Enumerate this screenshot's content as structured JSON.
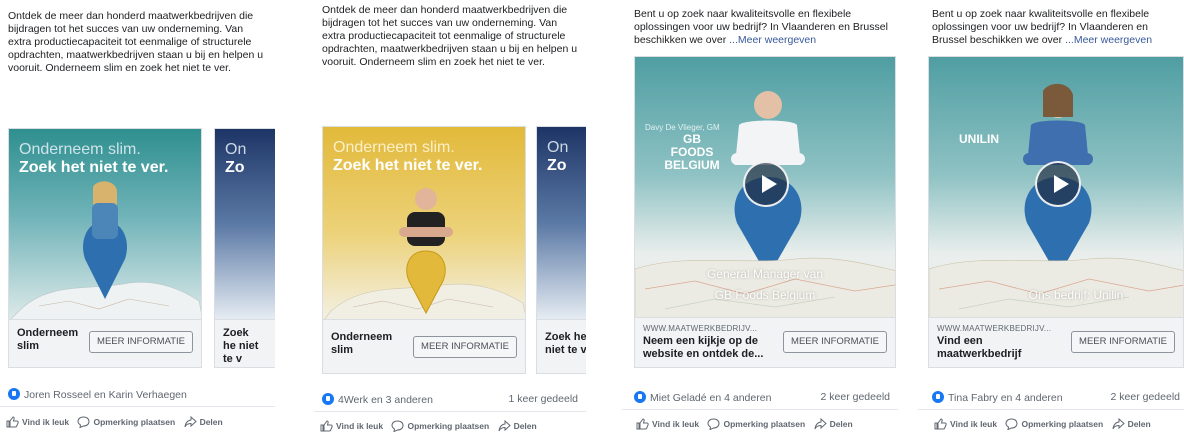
{
  "posts": [
    {
      "text": "Ontdek de meer dan honderd maatwerkbedrijven die bijdragen tot het succes van uw onderneming. Van extra productiecapaciteit tot eenmalige of structurele opdrachten, maatwerkbedrijven staan u bij en helpen u vooruit. Onderneem slim en zoek het niet te ver.",
      "card1": {
        "headline_light": "Onderneem slim.",
        "headline_bold": "Zoek het niet te ver.",
        "title": "Onderneem slim",
        "cta": "MEER INFORMATIE"
      },
      "card2": {
        "headline_light": "On",
        "headline_bold": "Zo",
        "title": "Zoek he niet te v"
      },
      "reactions": "Joren Rosseel en Karin Verhaegen",
      "shares": "",
      "actions": {
        "like": "Vind ik leuk",
        "comment": "Opmerking plaatsen",
        "share": "Delen"
      }
    },
    {
      "text": "Ontdek de meer dan honderd maatwerkbedrijven die bijdragen tot het succes van uw onderneming. Van extra productiecapaciteit tot eenmalige of structurele opdrachten, maatwerkbedrijven staan u bij en helpen u vooruit. Onderneem slim en zoek het niet te ver.",
      "card1": {
        "headline_light": "Onderneem slim.",
        "headline_bold": "Zoek het niet te ver.",
        "title": "Onderneem slim",
        "cta": "MEER INFORMATIE"
      },
      "card2": {
        "headline_light": "On",
        "headline_bold": "Zo",
        "title": "Zoek he niet te v"
      },
      "reactions": "4Werk en 3 anderen",
      "shares": "1 keer gedeeld",
      "actions": {
        "like": "Vind ik leuk",
        "comment": "Opmerking plaatsen",
        "share": "Delen"
      }
    },
    {
      "text": "Bent u op zoek naar kwaliteitsvolle en flexibele oplossingen voor uw bedrijf? In Vlaanderen en Brussel beschikken we over",
      "more": "...Meer weergeven",
      "video": {
        "name_tag": "Davy De Vlieger, GM",
        "brand": "GB FOODS BELGIUM",
        "caption_1": "General Manager van",
        "caption_2": "GB Foods Belgium"
      },
      "domain": "WWW.MAATWERKBEDRIJV...",
      "title": "Neem een kijkje op de website en ontdek de...",
      "cta": "MEER INFORMATIE",
      "reactions": "Miet Geladé en 4 anderen",
      "shares": "2 keer gedeeld",
      "actions": {
        "like": "Vind ik leuk",
        "comment": "Opmerking plaatsen",
        "share": "Delen"
      }
    },
    {
      "text": "Bent u op zoek naar kwaliteitsvolle en flexibele oplossingen voor uw bedrijf? In Vlaanderen en Brussel beschikken we over",
      "more": "...Meer weergeven",
      "video": {
        "brand": "UNILIN",
        "caption_1": "Ons bedrijf: Unilin"
      },
      "domain": "WWW.MAATWERKBEDRIJV...",
      "title": "Vind een maatwerkbedrijf",
      "cta": "MEER INFORMATIE",
      "reactions": "Tina Fabry en 4 anderen",
      "shares": "2 keer gedeeld",
      "actions": {
        "like": "Vind ik leuk",
        "comment": "Opmerking plaatsen",
        "share": "Delen"
      }
    }
  ],
  "colors": {
    "teal_top": "#2f8f8f",
    "teal_mid": "#6fb3b8",
    "navy": "#1d3566",
    "yellow": "#e2b93a",
    "brand_blue": "#1877f2",
    "pin_blue": "#2e6fb0"
  }
}
